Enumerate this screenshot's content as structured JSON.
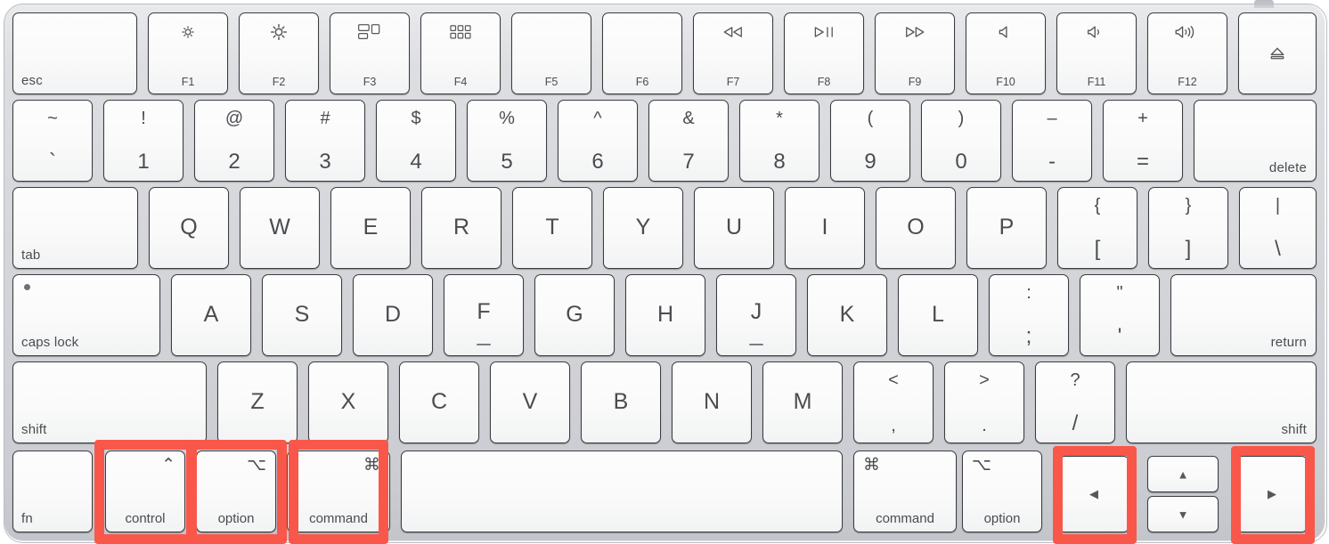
{
  "device": {
    "name": "Apple Magic Keyboard",
    "layout": "US English",
    "body_color": "#d3d5d9",
    "key_color": "#fafafa",
    "legend_color": "#4a4c50",
    "highlight_color": "#f9574a"
  },
  "annotation": {
    "style": "hand-drawn red rectangle outline",
    "color": "#f9574a",
    "highlighted_keys": [
      "control",
      "option",
      "command",
      "left-arrow",
      "right-arrow"
    ],
    "count": 5
  },
  "rows": [
    {
      "id": "function-row",
      "keys": [
        {
          "name": "esc",
          "word": "esc",
          "align": "left"
        },
        {
          "name": "f1",
          "fn": "F1",
          "icon": "brightness-down-icon"
        },
        {
          "name": "f2",
          "fn": "F2",
          "icon": "brightness-up-icon"
        },
        {
          "name": "f3",
          "fn": "F3",
          "icon": "mission-control-icon"
        },
        {
          "name": "f4",
          "fn": "F4",
          "icon": "launchpad-icon"
        },
        {
          "name": "f5",
          "fn": "F5",
          "icon": "none"
        },
        {
          "name": "f6",
          "fn": "F6",
          "icon": "none"
        },
        {
          "name": "f7",
          "fn": "F7",
          "icon": "rewind-icon"
        },
        {
          "name": "f8",
          "fn": "F8",
          "icon": "play-pause-icon"
        },
        {
          "name": "f9",
          "fn": "F9",
          "icon": "fast-forward-icon"
        },
        {
          "name": "f10",
          "fn": "F10",
          "icon": "mute-icon"
        },
        {
          "name": "f11",
          "fn": "F11",
          "icon": "volume-down-icon"
        },
        {
          "name": "f12",
          "fn": "F12",
          "icon": "volume-up-icon"
        },
        {
          "name": "eject",
          "fn": "",
          "icon": "eject-icon"
        }
      ]
    },
    {
      "id": "number-row",
      "keys": [
        {
          "name": "backtick",
          "top": "~",
          "bottom": "`"
        },
        {
          "name": "digit-1",
          "top": "!",
          "bottom": "1"
        },
        {
          "name": "digit-2",
          "top": "@",
          "bottom": "2"
        },
        {
          "name": "digit-3",
          "top": "#",
          "bottom": "3"
        },
        {
          "name": "digit-4",
          "top": "$",
          "bottom": "4"
        },
        {
          "name": "digit-5",
          "top": "%",
          "bottom": "5"
        },
        {
          "name": "digit-6",
          "top": "^",
          "bottom": "6"
        },
        {
          "name": "digit-7",
          "top": "&",
          "bottom": "7"
        },
        {
          "name": "digit-8",
          "top": "*",
          "bottom": "8"
        },
        {
          "name": "digit-9",
          "top": "(",
          "bottom": "9"
        },
        {
          "name": "digit-0",
          "top": ")",
          "bottom": "0"
        },
        {
          "name": "minus",
          "top": "–",
          "bottom": "-"
        },
        {
          "name": "equal",
          "top": "+",
          "bottom": "="
        },
        {
          "name": "delete",
          "word": "delete",
          "align": "right"
        }
      ]
    },
    {
      "id": "qwerty-row",
      "keys": [
        {
          "name": "tab",
          "word": "tab",
          "align": "left"
        },
        {
          "name": "key-q",
          "letter": "Q"
        },
        {
          "name": "key-w",
          "letter": "W"
        },
        {
          "name": "key-e",
          "letter": "E"
        },
        {
          "name": "key-r",
          "letter": "R"
        },
        {
          "name": "key-t",
          "letter": "T"
        },
        {
          "name": "key-y",
          "letter": "Y"
        },
        {
          "name": "key-u",
          "letter": "U"
        },
        {
          "name": "key-i",
          "letter": "I"
        },
        {
          "name": "key-o",
          "letter": "O"
        },
        {
          "name": "key-p",
          "letter": "P"
        },
        {
          "name": "bracket-left",
          "top": "{",
          "bottom": "["
        },
        {
          "name": "bracket-right",
          "top": "}",
          "bottom": "]"
        },
        {
          "name": "backslash",
          "top": "|",
          "bottom": "\\"
        }
      ]
    },
    {
      "id": "home-row",
      "keys": [
        {
          "name": "caps-lock",
          "word": "caps lock",
          "align": "left",
          "led": true
        },
        {
          "name": "key-a",
          "letter": "A"
        },
        {
          "name": "key-s",
          "letter": "S"
        },
        {
          "name": "key-d",
          "letter": "D"
        },
        {
          "name": "key-f",
          "letter": "F",
          "homing": true
        },
        {
          "name": "key-g",
          "letter": "G"
        },
        {
          "name": "key-h",
          "letter": "H"
        },
        {
          "name": "key-j",
          "letter": "J",
          "homing": true
        },
        {
          "name": "key-k",
          "letter": "K"
        },
        {
          "name": "key-l",
          "letter": "L"
        },
        {
          "name": "semicolon",
          "top": ":",
          "bottom": ";"
        },
        {
          "name": "quote",
          "top": "\"",
          "bottom": "'"
        },
        {
          "name": "return",
          "word": "return",
          "align": "right"
        }
      ]
    },
    {
      "id": "shift-row",
      "keys": [
        {
          "name": "shift-left",
          "word": "shift",
          "align": "left"
        },
        {
          "name": "key-z",
          "letter": "Z"
        },
        {
          "name": "key-x",
          "letter": "X"
        },
        {
          "name": "key-c",
          "letter": "C"
        },
        {
          "name": "key-v",
          "letter": "V"
        },
        {
          "name": "key-b",
          "letter": "B"
        },
        {
          "name": "key-n",
          "letter": "N"
        },
        {
          "name": "key-m",
          "letter": "M"
        },
        {
          "name": "comma",
          "top": "<",
          "bottom": ","
        },
        {
          "name": "period",
          "top": ">",
          "bottom": "."
        },
        {
          "name": "slash",
          "top": "?",
          "bottom": "/"
        },
        {
          "name": "shift-right",
          "word": "shift",
          "align": "right"
        }
      ]
    },
    {
      "id": "bottom-row",
      "keys": [
        {
          "name": "fn",
          "word": "fn",
          "align": "left"
        },
        {
          "name": "control-left",
          "modword": "control",
          "modglyph": "⌃",
          "highlighted": true
        },
        {
          "name": "option-left",
          "modword": "option",
          "modglyph": "⌥",
          "highlighted": true
        },
        {
          "name": "command-left",
          "modword": "command",
          "modglyph": "⌘",
          "highlighted": true
        },
        {
          "name": "space",
          "word": "",
          "align": "center"
        },
        {
          "name": "command-right",
          "modword": "command",
          "modglyph": "⌘",
          "highlighted": false
        },
        {
          "name": "option-right",
          "modword": "option",
          "modglyph": "⌥",
          "highlighted": false
        },
        {
          "name": "arrow-left",
          "arrow": "◀",
          "highlighted": true
        },
        {
          "name": "arrow-up",
          "arrow": "▲",
          "highlighted": false
        },
        {
          "name": "arrow-down",
          "arrow": "▼",
          "highlighted": false
        },
        {
          "name": "arrow-right",
          "arrow": "▶",
          "highlighted": true
        }
      ]
    }
  ]
}
